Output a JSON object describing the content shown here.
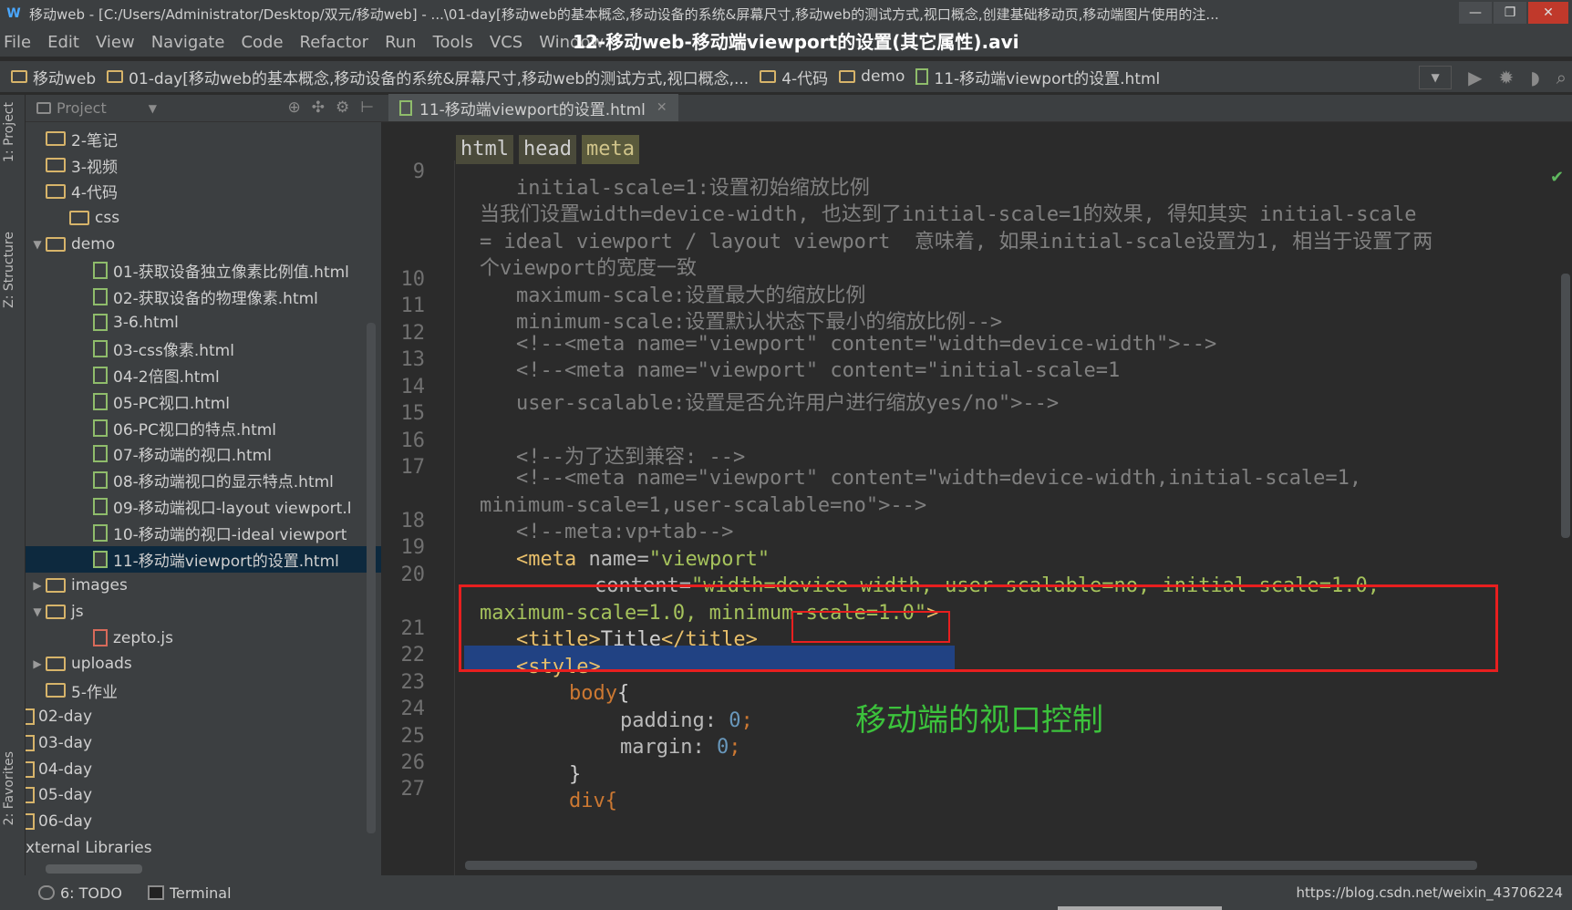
{
  "window": {
    "title": "移动web - [C:/Users/Administrator/Desktop/双元/移动web] - ...\\01-day[移动web的基本概念,移动设备的系统&屏幕尺寸,移动web的测试方式,视口概念,创建基础移动页,移动端图片使用的注...",
    "video_title": "12-移动web-移动端viewport的设置(其它属性).avi"
  },
  "menu": [
    "File",
    "Edit",
    "View",
    "Navigate",
    "Code",
    "Refactor",
    "Run",
    "Tools",
    "VCS",
    "Window"
  ],
  "breadcrumbs": [
    {
      "label": "移动web",
      "type": "folder"
    },
    {
      "label": "01-day[移动web的基本概念,移动设备的系统&屏幕尺寸,移动web的测试方式,视口概念,...",
      "type": "folder"
    },
    {
      "label": "4-代码",
      "type": "folder"
    },
    {
      "label": "demo",
      "type": "folder"
    },
    {
      "label": "11-移动端viewport的设置.html",
      "type": "file"
    }
  ],
  "left_stripe": {
    "project": "1: Project",
    "structure": "Z: Structure",
    "favorites": "2: Favorites"
  },
  "project_panel": {
    "header": "Project",
    "tree": [
      {
        "label": "2-笔记",
        "type": "folder",
        "indent": 0,
        "arrow": ""
      },
      {
        "label": "3-视频",
        "type": "folder",
        "indent": 0,
        "arrow": ""
      },
      {
        "label": "4-代码",
        "type": "folder",
        "indent": 0,
        "arrow": ""
      },
      {
        "label": "css",
        "type": "folder",
        "indent": 1,
        "arrow": ""
      },
      {
        "label": "demo",
        "type": "folder",
        "indent": 0,
        "arrow": "▼"
      },
      {
        "label": "01-获取设备独立像素比例值.html",
        "type": "html",
        "indent": 2,
        "arrow": ""
      },
      {
        "label": "02-获取设备的物理像素.html",
        "type": "html",
        "indent": 2,
        "arrow": ""
      },
      {
        "label": "3-6.html",
        "type": "html",
        "indent": 2,
        "arrow": ""
      },
      {
        "label": "03-css像素.html",
        "type": "html",
        "indent": 2,
        "arrow": ""
      },
      {
        "label": "04-2倍图.html",
        "type": "html",
        "indent": 2,
        "arrow": ""
      },
      {
        "label": "05-PC视口.html",
        "type": "html",
        "indent": 2,
        "arrow": ""
      },
      {
        "label": "06-PC视口的特点.html",
        "type": "html",
        "indent": 2,
        "arrow": ""
      },
      {
        "label": "07-移动端的视口.html",
        "type": "html",
        "indent": 2,
        "arrow": ""
      },
      {
        "label": "08-移动端视口的显示特点.html",
        "type": "html",
        "indent": 2,
        "arrow": ""
      },
      {
        "label": "09-移动端视口-layout viewport.l",
        "type": "html",
        "indent": 2,
        "arrow": ""
      },
      {
        "label": "10-移动端的视口-ideal viewport",
        "type": "html",
        "indent": 2,
        "arrow": ""
      },
      {
        "label": "11-移动端viewport的设置.html",
        "type": "html",
        "indent": 2,
        "arrow": "",
        "selected": true
      },
      {
        "label": "images",
        "type": "folder",
        "indent": 0,
        "arrow": "▶"
      },
      {
        "label": "js",
        "type": "folder",
        "indent": 0,
        "arrow": "▼"
      },
      {
        "label": "zepto.js",
        "type": "js",
        "indent": 2,
        "arrow": ""
      },
      {
        "label": "uploads",
        "type": "folder",
        "indent": 0,
        "arrow": "▶"
      },
      {
        "label": "5-作业",
        "type": "folder",
        "indent": 0,
        "arrow": ""
      },
      {
        "label": "02-day",
        "type": "module",
        "indent": -1,
        "arrow": ""
      },
      {
        "label": "03-day",
        "type": "module",
        "indent": -1,
        "arrow": ""
      },
      {
        "label": "04-day",
        "type": "module",
        "indent": -1,
        "arrow": ""
      },
      {
        "label": "05-day",
        "type": "module",
        "indent": -1,
        "arrow": ""
      },
      {
        "label": "06-day",
        "type": "module",
        "indent": -1,
        "arrow": ""
      },
      {
        "label": "xternal Libraries",
        "type": "none",
        "indent": -1,
        "arrow": ""
      }
    ]
  },
  "editor": {
    "tab_label": "11-移动端viewport的设置.html",
    "html_crumbs": [
      "html",
      "head",
      "meta"
    ],
    "line_numbers": [
      "9",
      "10",
      "11",
      "12",
      "13",
      "14",
      "15",
      "16",
      "17",
      "18",
      "19",
      "20",
      "21",
      "22",
      "23",
      "24",
      "25",
      "26",
      "27"
    ],
    "lines": {
      "l9": "initial-scale=1:设置初始缩放比例",
      "l9b": "当我们设置width=device-width, 也达到了initial-scale=1的效果, 得知其实 initial-scale",
      "l9c": "= ideal viewport / layout viewport  意味着, 如果initial-scale设置为1, 相当于设置了两",
      "l9d": "个viewport的宽度一致",
      "l10": "maximum-scale:设置最大的缩放比例",
      "l11": "minimum-scale:设置默认状态下最小的缩放比例-->",
      "l12": "<!--<meta name=\"viewport\" content=\"width=device-width\">-->",
      "l13": "<!--<meta name=\"viewport\" content=\"initial-scale=1",
      "l14": "user-scalable:设置是否允许用户进行缩放yes/no\">-->",
      "l16": "<!--为了达到兼容: -->",
      "l17": "<!--<meta name=\"viewport\" content=\"width=device-width,initial-scale=1,",
      "l17b": "minimum-scale=1,user-scalable=no\">-->",
      "l18": "<!--meta:vp+tab-->",
      "l19_tag": "<meta",
      "l19_attr": " name=",
      "l19_val": "\"viewport\"",
      "l20_attr": "content=",
      "l20_val": "\"width=device-width, user-scalable=no, initial-scale=1.0,",
      "l20b_val": "maximum-scale=1.0, minimum-scale=1.0\"",
      "l20b_end": ">",
      "l21_open": "<title>",
      "l21_text": "Title",
      "l21_close": "</title>",
      "l22": "<style>",
      "l23_sel": "body",
      "l23_brace": "{",
      "l24_prop": "padding: ",
      "l24_num": "0",
      "l24_semi": ";",
      "l25_prop": "margin: ",
      "l25_num": "0",
      "l25_semi": ";",
      "l26": "}",
      "l27": "div{"
    },
    "annotation": "移动端的视口控制"
  },
  "status": {
    "todo": "6: TODO",
    "terminal": "Terminal",
    "watermark": "https://blog.csdn.net/weixin_43706224"
  },
  "colors": {
    "editor_bg": "#2b2b2b",
    "panel_bg": "#3c3f41",
    "highlight_box": "#e81f1f",
    "annotation": "#3cc23c",
    "selection": "#214283"
  }
}
